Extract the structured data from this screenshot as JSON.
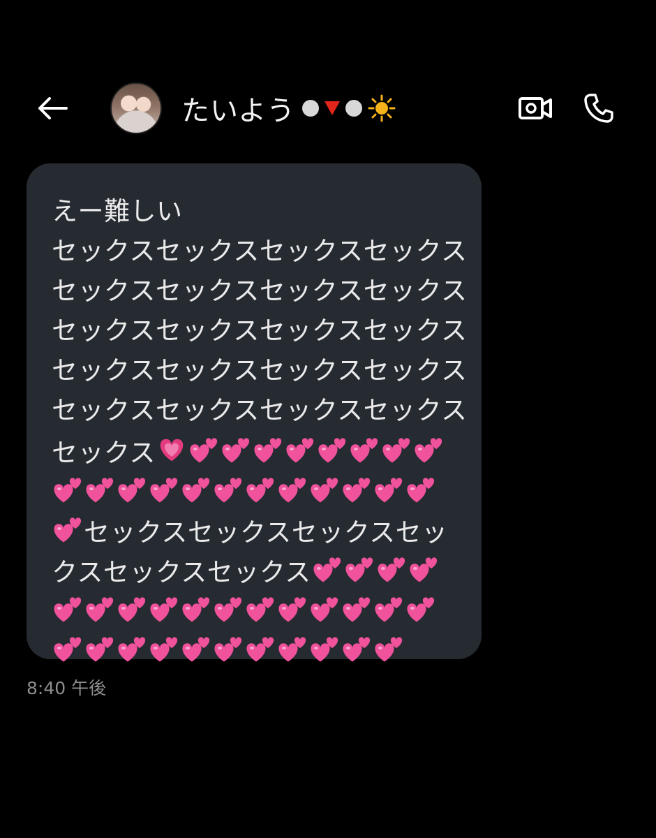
{
  "header": {
    "contact_name": "たいよう",
    "back_icon": "arrow-left-icon",
    "video_icon": "video-call-icon",
    "phone_icon": "phone-icon",
    "status_colors": {
      "dot": "#d8d8d8",
      "triangle": "#e0261b",
      "sun": "#f6b21a"
    }
  },
  "message": {
    "lines": [
      "えー難しい",
      "セックスセックスセックスセックス",
      "セックスセックスセックスセックス",
      "セックスセックスセックスセックス",
      "セックスセックスセックスセックス",
      "セックスセックスセックスセックス"
    ],
    "row6_text": "セックス",
    "row8_text": "セックスセックスセックスセッ",
    "row9_text": "クスセックスセックス",
    "bubble_color": "#262a31",
    "heart_color": "#f0529c"
  },
  "timestamp": "8:40 午後"
}
